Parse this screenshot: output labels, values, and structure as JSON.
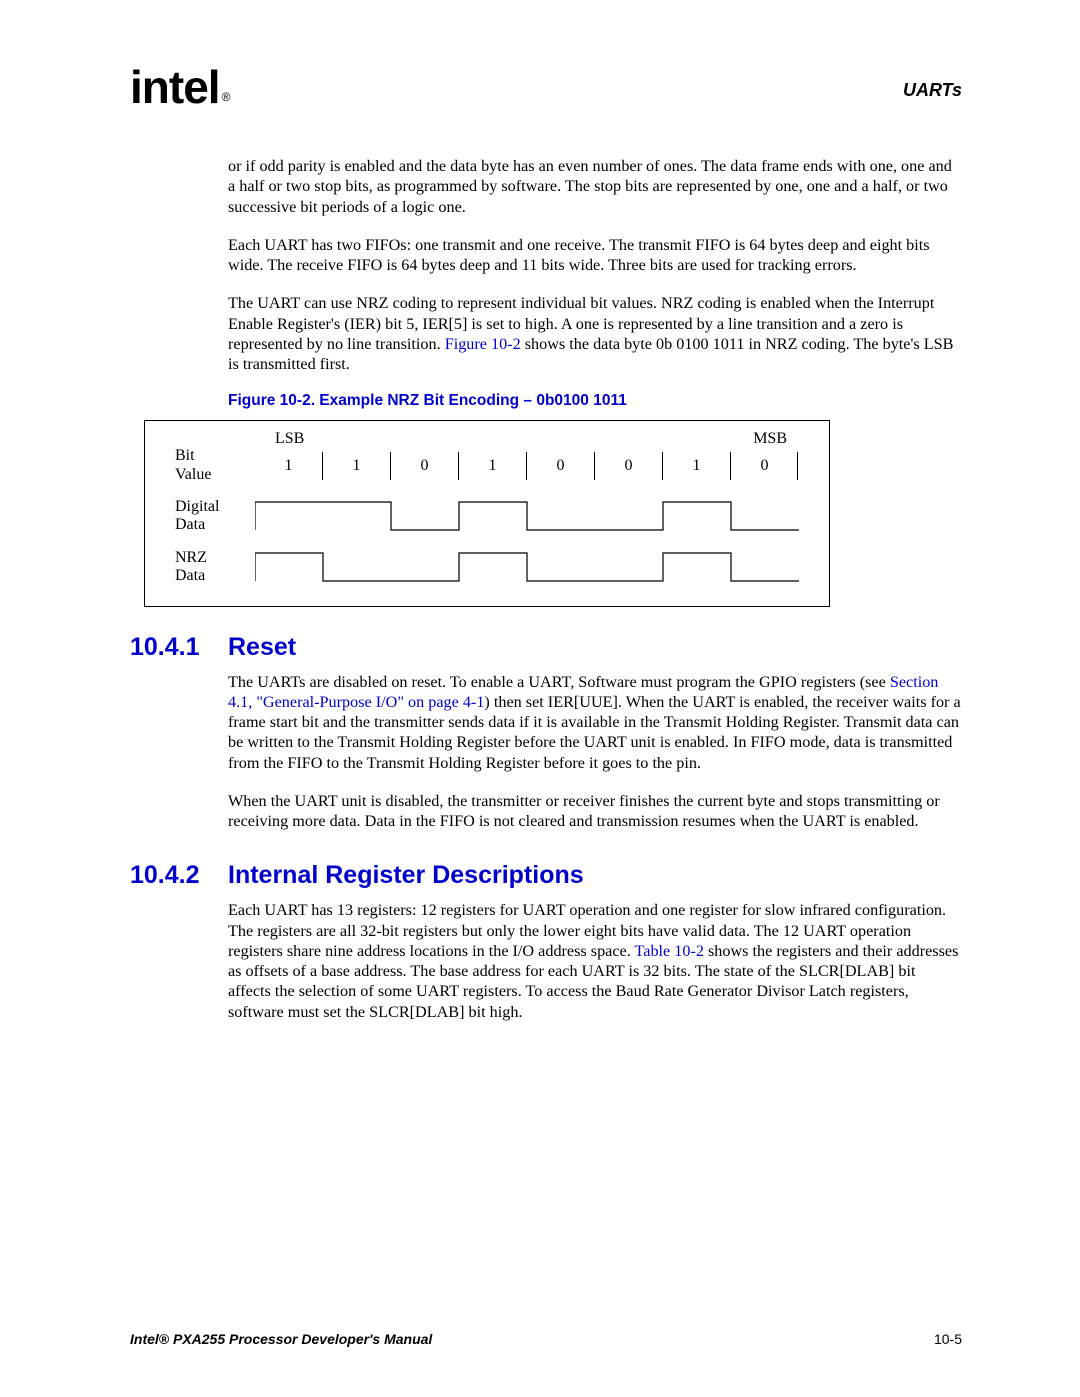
{
  "header": {
    "logo": "intel",
    "logo_reg": "®",
    "title": "UARTs"
  },
  "paragraphs": {
    "p1": "or if odd parity is enabled and the data byte has an even number of ones. The data frame ends with one, one and a half or two stop bits, as programmed by software. The stop bits are represented by one, one and a half, or two successive bit periods of a logic one.",
    "p2": "Each UART has two FIFOs: one transmit and one receive. The transmit FIFO is 64 bytes deep and eight bits wide. The receive FIFO is 64 bytes deep and 11 bits wide. Three bits are used for tracking errors.",
    "p3a": "The UART can use NRZ coding to represent individual bit values. NRZ coding is enabled when the Interrupt Enable Register's (IER) bit 5, IER[5] is set to high. A one is represented by a line transition and a zero is represented by no line transition. ",
    "p3_link": "Figure 10-2",
    "p3b": " shows the data byte 0b 0100 1011 in NRZ coding. The byte's LSB is transmitted first."
  },
  "figure": {
    "caption": "Figure 10-2. Example NRZ Bit Encoding – 0b0100 1011",
    "lsb": "LSB",
    "msb": "MSB",
    "bit_label": "Bit",
    "value_label": "Value",
    "digital_label": "Digital",
    "data_label": "Data",
    "nrz_label": "NRZ",
    "bits": [
      "1",
      "1",
      "0",
      "1",
      "0",
      "0",
      "1",
      "0"
    ]
  },
  "sections": {
    "s1_num": "10.4.1",
    "s1_title": "Reset",
    "s1_p1a": "The UARTs are disabled on reset. To enable a UART, Software must program the GPIO registers (see ",
    "s1_link": "Section 4.1, \"General-Purpose I/O\" on page 4-1",
    "s1_p1b": ") then set IER[UUE]. When the UART is enabled, the receiver waits for a frame start bit and the transmitter sends data if it is available in the Transmit Holding Register. Transmit data can be written to the Transmit Holding Register before the UART unit is enabled. In FIFO mode, data is transmitted from the FIFO to the Transmit Holding Register before it goes to the pin.",
    "s1_p2": "When the UART unit is disabled, the transmitter or receiver finishes the current byte and stops transmitting or receiving more data. Data in the FIFO is not cleared and transmission resumes when the UART is enabled.",
    "s2_num": "10.4.2",
    "s2_title": "Internal Register Descriptions",
    "s2_p1a": "Each UART has 13 registers: 12 registers for UART operation and one register for slow infrared configuration. The registers are all 32-bit registers but only the lower eight bits have valid data. The 12 UART operation registers share nine address locations in the I/O address space. ",
    "s2_link": "Table 10-2",
    "s2_p1b": " shows the registers and their addresses as offsets of a base address. The base address for each UART is 32 bits. The state of the SLCR[DLAB] bit affects the selection of some UART registers. To access the Baud Rate Generator Divisor Latch registers, software must set the SLCR[DLAB] bit high."
  },
  "footer": {
    "left": "Intel® PXA255 Processor Developer's Manual",
    "right": "10-5"
  }
}
